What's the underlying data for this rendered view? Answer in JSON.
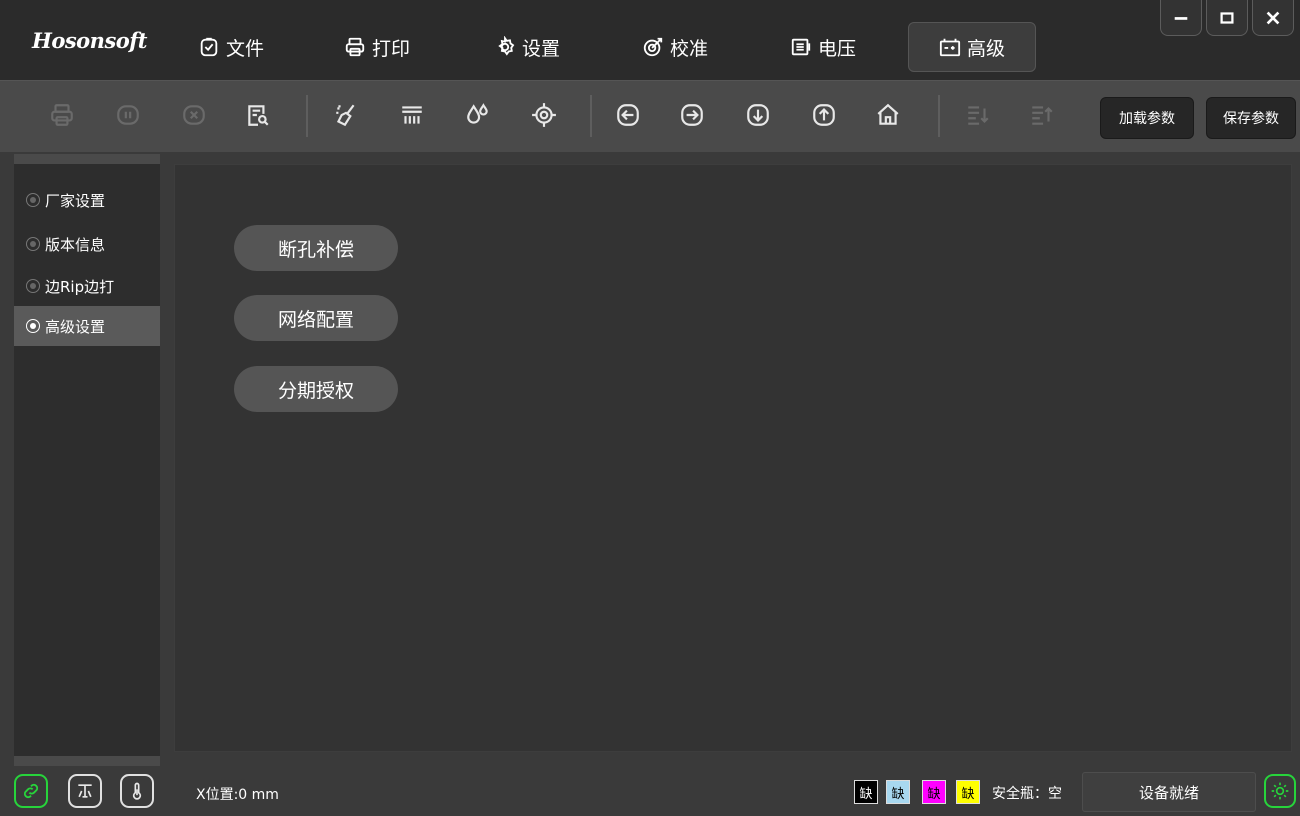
{
  "app": {
    "logo": "Hosonsoft"
  },
  "menu": {
    "items": [
      {
        "label": "文件",
        "icon": "file-check-icon"
      },
      {
        "label": "打印",
        "icon": "printer-icon"
      },
      {
        "label": "设置",
        "icon": "gear-icon"
      },
      {
        "label": "校准",
        "icon": "target-icon"
      },
      {
        "label": "电压",
        "icon": "voltage-icon"
      },
      {
        "label": "高级",
        "icon": "battery-icon"
      }
    ],
    "active": "高级"
  },
  "window_controls": [
    "minimize-icon",
    "maximize-icon",
    "close-icon"
  ],
  "toolbar": {
    "icons": [
      "printer-icon",
      "pause-icon",
      "cancel-icon",
      "preview-icon",
      "clean-icon",
      "stripe-icon",
      "ink-drop-icon",
      "crosshair-icon",
      "arrow-left-icon",
      "arrow-right-icon",
      "arrow-down-icon",
      "arrow-up-icon",
      "home-icon",
      "sort-down-icon",
      "sort-up-icon"
    ],
    "load_params": "加载参数",
    "save_params": "保存参数"
  },
  "sidebar": {
    "items": [
      {
        "label": "厂家设置",
        "active": false
      },
      {
        "label": "版本信息",
        "active": false
      },
      {
        "label": "边Rip边打",
        "active": false
      },
      {
        "label": "高级设置",
        "active": true
      }
    ]
  },
  "main": {
    "buttons": [
      {
        "label": "断孔补偿"
      },
      {
        "label": "网络配置"
      },
      {
        "label": "分期授权"
      }
    ]
  },
  "status": {
    "icons": [
      "link-icon",
      "network-icon",
      "thermometer-icon"
    ],
    "x_position": "X位置:0 mm",
    "inks": [
      {
        "label": "缺",
        "color": "#000000",
        "text_color": "#ffffff"
      },
      {
        "label": "缺",
        "color": "#a8d8f0",
        "text_color": "#000000"
      },
      {
        "label": "缺",
        "color": "#ff00ff",
        "text_color": "#000000"
      },
      {
        "label": "缺",
        "color": "#ffff00",
        "text_color": "#000000"
      }
    ],
    "safety_bottle": "安全瓶：空",
    "device_status": "设备就绪",
    "light_icon": "light-bulb-icon"
  },
  "colors": {
    "title_bg": "#2b2b2b",
    "toolbar_bg": "#4a4a4a",
    "content_bg": "#333333",
    "pill_bg": "#555555",
    "status_green": "#27d43b"
  }
}
